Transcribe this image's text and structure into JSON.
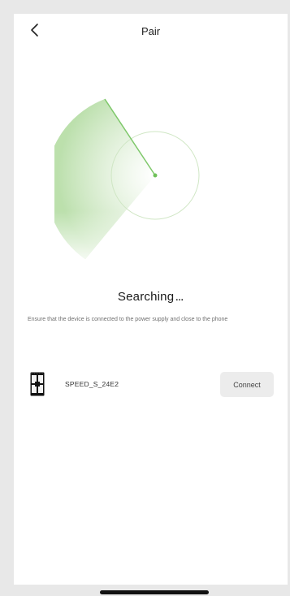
{
  "header": {
    "title": "Pair"
  },
  "status": {
    "title": "Searching",
    "dots": "...",
    "hint": "Ensure that the device is connected to the power supply and close to the phone"
  },
  "devices": [
    {
      "name": "SPEED_S_24E2",
      "action_label": "Connect"
    }
  ],
  "icons": {
    "back": "chevron-left-icon",
    "device": "scale-device-icon"
  },
  "colors": {
    "accent": "#6fc15a",
    "radar_fill": "#cfe9c3",
    "button_bg": "#ececec"
  }
}
